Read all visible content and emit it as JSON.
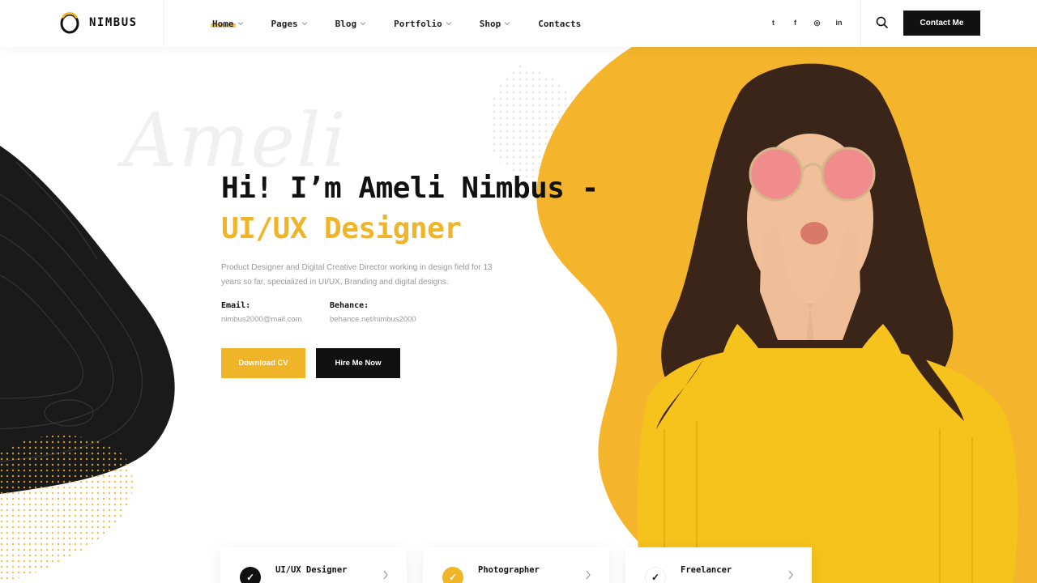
{
  "brand": {
    "name": "NIMBUS"
  },
  "nav": {
    "items": [
      {
        "label": "Home",
        "has_dropdown": true,
        "active": true
      },
      {
        "label": "Pages",
        "has_dropdown": true
      },
      {
        "label": "Blog",
        "has_dropdown": true
      },
      {
        "label": "Portfolio",
        "has_dropdown": true
      },
      {
        "label": "Shop",
        "has_dropdown": true
      },
      {
        "label": "Contacts",
        "has_dropdown": false
      }
    ]
  },
  "socials": [
    {
      "icon": "twitter-icon",
      "glyph": "t"
    },
    {
      "icon": "facebook-icon",
      "glyph": "f"
    },
    {
      "icon": "instagram-icon",
      "glyph": "◎"
    },
    {
      "icon": "linkedin-icon",
      "glyph": "in"
    }
  ],
  "header": {
    "contact_button": "Contact Me"
  },
  "hero": {
    "script_name": "Ameli",
    "title": "Hi! I’m Ameli Nimbus -",
    "subtitle": "UI/UX Designer",
    "description": "Product Designer and Digital Creative Director working in design field for 13 years so far, specialized in UI/UX, Branding and digital designs.",
    "email_label": "Email:",
    "email_value": "nimbus2000@mail.com",
    "behance_label": "Behance:",
    "behance_value": "behance.net/nimbus2000",
    "download_button": "Download CV",
    "hire_button": "Hire Me Now"
  },
  "cards": [
    {
      "title": "UI/UX Designer",
      "icon_color": "#111111"
    },
    {
      "title": "Photographer",
      "icon_color": "#f0b429"
    },
    {
      "title": "Freelancer",
      "icon_color": "#ffffff"
    }
  ],
  "colors": {
    "accent": "#f0b429",
    "dark": "#111111",
    "muted": "#999999"
  }
}
